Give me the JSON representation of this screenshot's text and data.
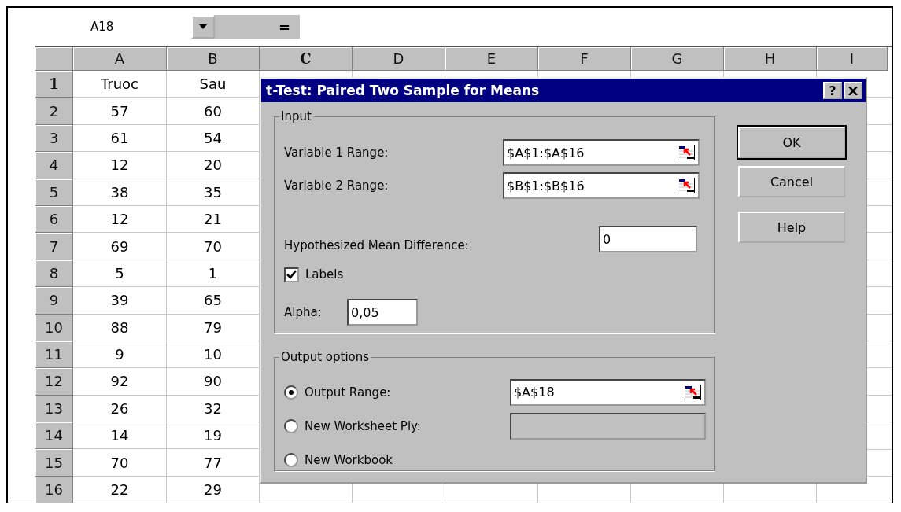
{
  "name_box": {
    "value": "A18"
  },
  "formula_bar": {
    "symbol": "="
  },
  "columns": [
    {
      "label": "A",
      "selected": false
    },
    {
      "label": "B",
      "selected": false
    },
    {
      "label": "C",
      "selected": true
    },
    {
      "label": "D",
      "selected": false
    },
    {
      "label": "E",
      "selected": false
    },
    {
      "label": "F",
      "selected": false
    },
    {
      "label": "G",
      "selected": false
    },
    {
      "label": "H",
      "selected": false
    },
    {
      "label": "I",
      "selected": false
    }
  ],
  "rows": [
    {
      "header": "1",
      "selected": true,
      "cells": [
        "Truoc",
        "Sau"
      ]
    },
    {
      "header": "2",
      "selected": false,
      "cells": [
        "57",
        "60"
      ]
    },
    {
      "header": "3",
      "selected": false,
      "cells": [
        "61",
        "54"
      ]
    },
    {
      "header": "4",
      "selected": false,
      "cells": [
        "12",
        "20"
      ]
    },
    {
      "header": "5",
      "selected": false,
      "cells": [
        "38",
        "35"
      ]
    },
    {
      "header": "6",
      "selected": false,
      "cells": [
        "12",
        "21"
      ]
    },
    {
      "header": "7",
      "selected": false,
      "cells": [
        "69",
        "70"
      ]
    },
    {
      "header": "8",
      "selected": false,
      "cells": [
        "5",
        "1"
      ]
    },
    {
      "header": "9",
      "selected": false,
      "cells": [
        "39",
        "65"
      ]
    },
    {
      "header": "10",
      "selected": false,
      "cells": [
        "88",
        "79"
      ]
    },
    {
      "header": "11",
      "selected": false,
      "cells": [
        "9",
        "10"
      ]
    },
    {
      "header": "12",
      "selected": false,
      "cells": [
        "92",
        "90"
      ]
    },
    {
      "header": "13",
      "selected": false,
      "cells": [
        "26",
        "32"
      ]
    },
    {
      "header": "14",
      "selected": false,
      "cells": [
        "14",
        "19"
      ]
    },
    {
      "header": "15",
      "selected": false,
      "cells": [
        "70",
        "77"
      ]
    },
    {
      "header": "16",
      "selected": false,
      "cells": [
        "22",
        "29"
      ]
    }
  ],
  "dialog": {
    "title": "t-Test: Paired Two Sample for Means",
    "help_button": "?",
    "input": {
      "legend": "Input",
      "fields": [
        {
          "kind": "range",
          "label": "Variable 1 Range:",
          "value": "$A$1:$A$16"
        },
        {
          "kind": "range",
          "label": "Variable 2 Range:",
          "value": "$B$1:$B$16"
        },
        {
          "kind": "number",
          "label": "Hypothesized Mean Difference:",
          "value": "0"
        },
        {
          "kind": "checkbox",
          "label": "Labels",
          "checked": true
        },
        {
          "kind": "short",
          "label": "Alpha:",
          "value": "0,05"
        }
      ]
    },
    "output": {
      "legend": "Output options",
      "options": [
        {
          "label": "Output Range:",
          "selected": true,
          "field": {
            "value": "$A$18",
            "disabled": false
          }
        },
        {
          "label": "New Worksheet Ply:",
          "selected": false,
          "field": {
            "disabled": true
          }
        },
        {
          "label": "New Workbook",
          "selected": false
        }
      ]
    },
    "buttons": [
      {
        "label": "OK",
        "default": true
      },
      {
        "label": "Cancel",
        "default": false
      },
      {
        "label": "Help",
        "default": false
      }
    ]
  }
}
